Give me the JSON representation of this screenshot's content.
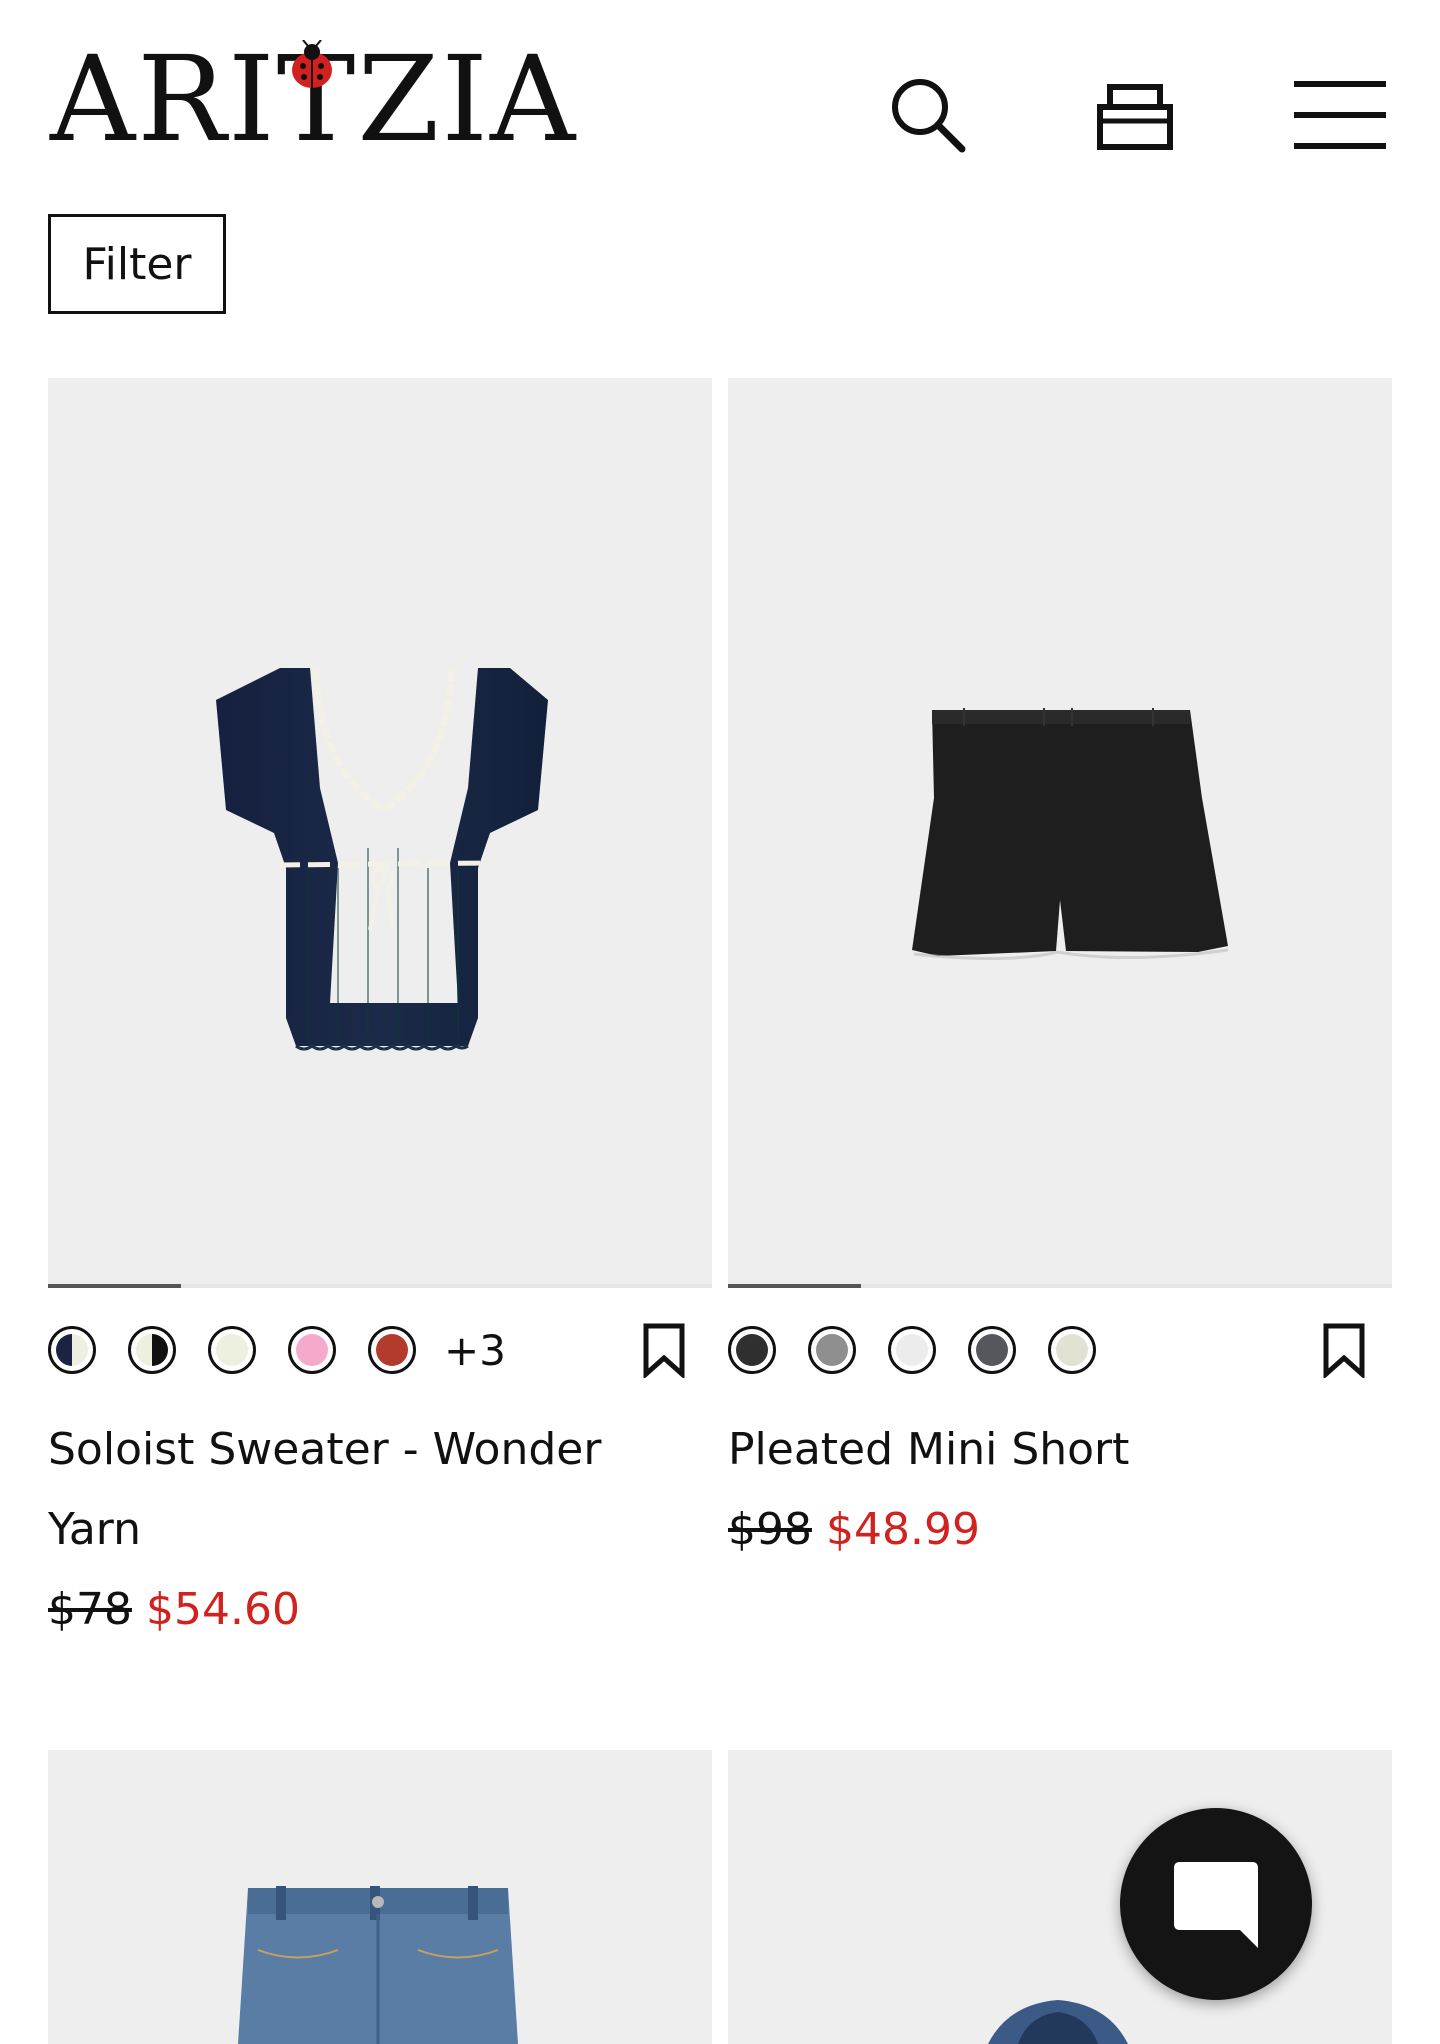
{
  "header": {
    "logo_text": "ARITZIA",
    "icons": [
      "search-icon",
      "shopping-bag-icon",
      "menu-icon"
    ]
  },
  "filter": {
    "label": "Filter"
  },
  "products": [
    {
      "name": "Soloist Sweater - Wonder Yarn",
      "price_original": "$78",
      "price_sale": "$54.60",
      "swatches": [
        "#1c2340",
        "#e9ead9",
        "#eef0df",
        "#f5aacb",
        "#b23b2b"
      ],
      "more_colors": "+3",
      "image_progress": 0.2
    },
    {
      "name": "Pleated Mini Short",
      "price_original": "$98",
      "price_sale": "$48.99",
      "swatches": [
        "#2f2f2f",
        "#8f8f8f",
        "#ececec",
        "#55575c",
        "#e2e2d4"
      ],
      "image_progress": 0.2
    }
  ],
  "colors": {
    "sale_red": "#d0221f",
    "card_bg": "#eeeeee",
    "chat_bg": "#141414"
  }
}
